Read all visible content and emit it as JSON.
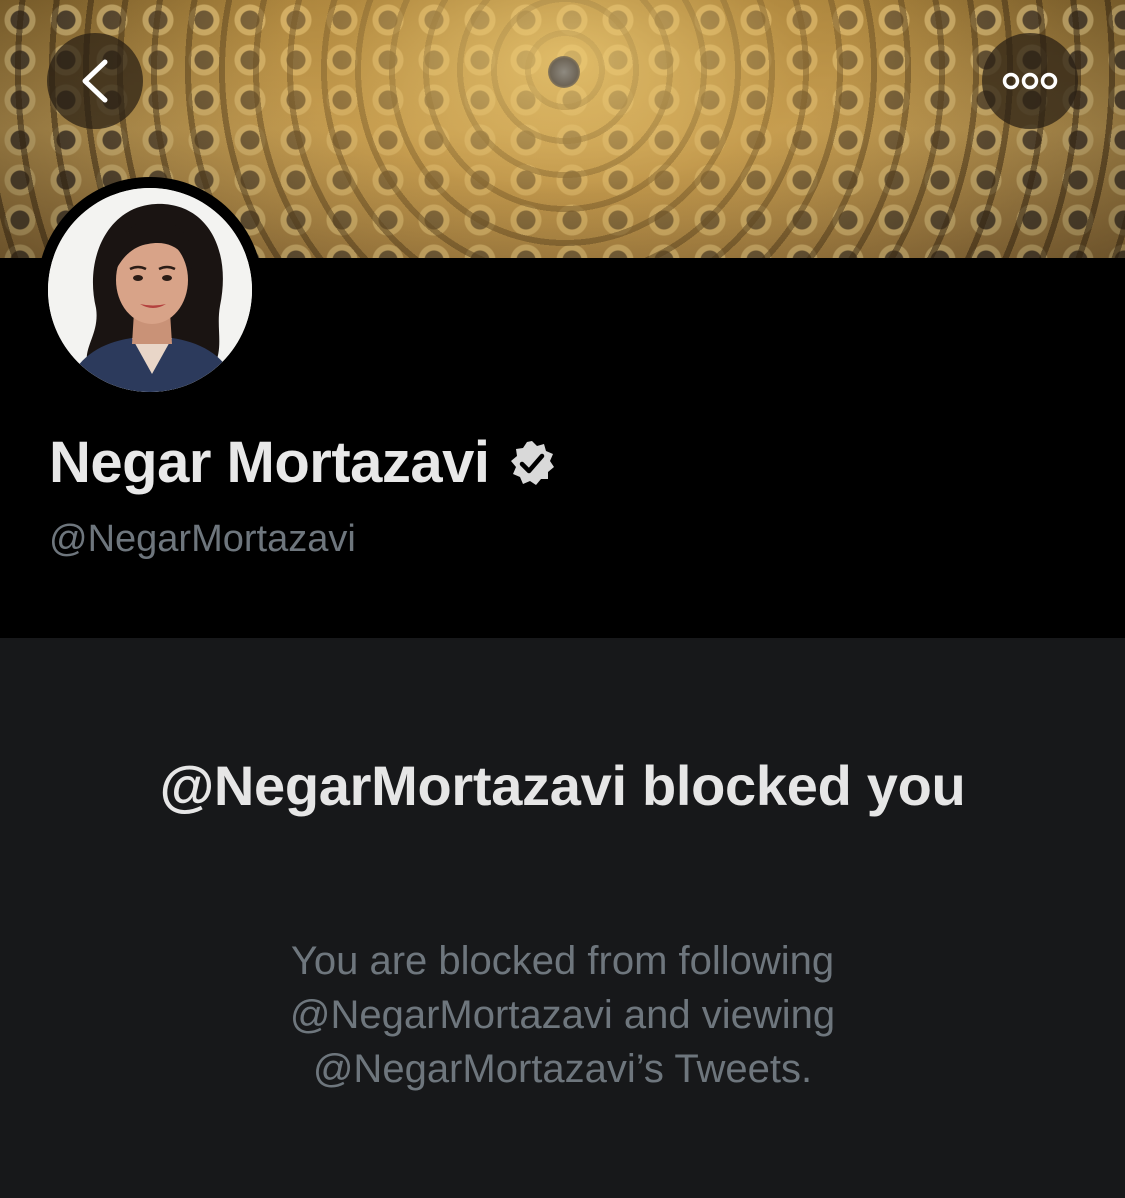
{
  "header": {
    "back_icon": "chevron-left-icon",
    "more_icon": "more-horizontal-icon"
  },
  "profile": {
    "display_name": "Negar Mortazavi",
    "verified": true,
    "verified_icon": "verified-badge-icon",
    "handle": "@NegarMortazavi"
  },
  "blocked": {
    "title": "@NegarMortazavi blocked you",
    "message": "You are blocked from following @NegarMortazavi and viewing @NegarMortazavi’s Tweets."
  },
  "colors": {
    "background": "#000000",
    "panel": "#17181a",
    "primary_text": "#e8e8e8",
    "secondary_text": "#6e767d"
  }
}
